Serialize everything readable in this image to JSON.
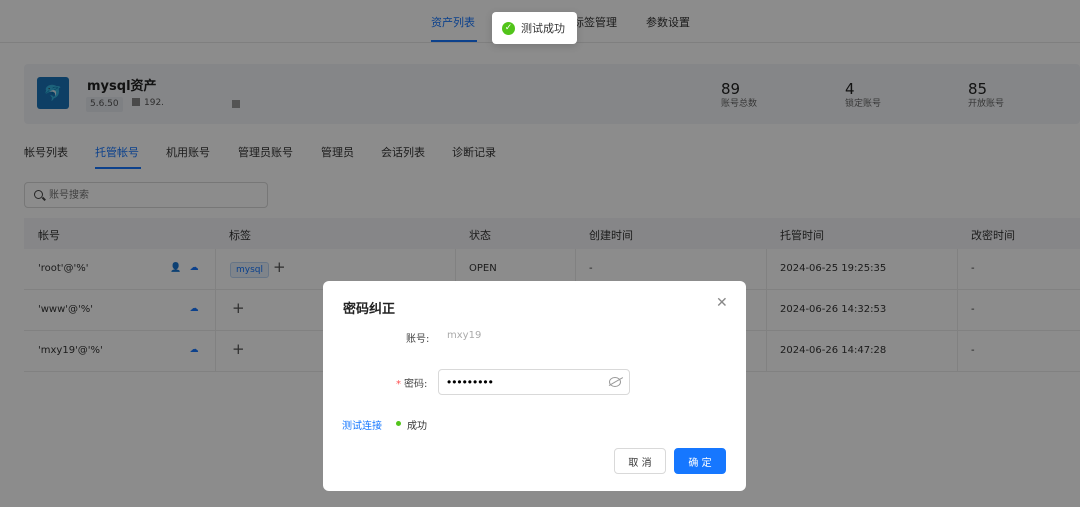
{
  "top_tabs": [
    {
      "label": "资产列表",
      "active": true
    },
    {
      "label": "标签管理",
      "active": false
    },
    {
      "label": "参数设置",
      "active": false
    }
  ],
  "toast": {
    "text": "测试成功",
    "icon": "check-circle-icon",
    "color": "#52c41a"
  },
  "asset": {
    "name": "mysql资产",
    "version": "5.6.50",
    "ip": "192.",
    "logo_icon": "mysql-dolphin-icon",
    "stats": [
      {
        "value": "89",
        "label": "账号总数"
      },
      {
        "value": "4",
        "label": "锁定账号"
      },
      {
        "value": "85",
        "label": "开放账号"
      }
    ]
  },
  "sub_tabs": [
    {
      "label": "帐号列表",
      "active": false
    },
    {
      "label": "托管帐号",
      "active": true
    },
    {
      "label": "机用账号",
      "active": false
    },
    {
      "label": "管理员账号",
      "active": false
    },
    {
      "label": "管理员",
      "active": false
    },
    {
      "label": "会话列表",
      "active": false
    },
    {
      "label": "诊断记录",
      "active": false
    }
  ],
  "search": {
    "placeholder": "账号搜索",
    "value": ""
  },
  "table": {
    "columns": [
      "帐号",
      "标签",
      "状态",
      "创建时间",
      "托管时间",
      "改密时间"
    ],
    "rows": [
      {
        "account": "'root'@'%'",
        "tag": "mysql",
        "status": "OPEN",
        "created": "-",
        "hosted": "2024-06-25 19:25:35",
        "changed": "-"
      },
      {
        "account": "'www'@'%'",
        "tag": "",
        "status": "",
        "created": "",
        "hosted": "2024-06-26 14:32:53",
        "changed": "-"
      },
      {
        "account": "'mxy19'@'%'",
        "tag": "",
        "status": "",
        "created": "",
        "hosted": "2024-06-26 14:47:28",
        "changed": "-"
      }
    ]
  },
  "modal": {
    "title": "密码纠正",
    "account_label": "账号:",
    "account_value": "mxy19",
    "required_mark": "*",
    "password_label": "密码:",
    "password_value": "•••••••••",
    "test_link": "测试连接",
    "test_result": "成功",
    "cancel_label": "取 消",
    "confirm_label": "确 定",
    "close_icon": "close-icon",
    "accent_color": "#1677ff"
  }
}
